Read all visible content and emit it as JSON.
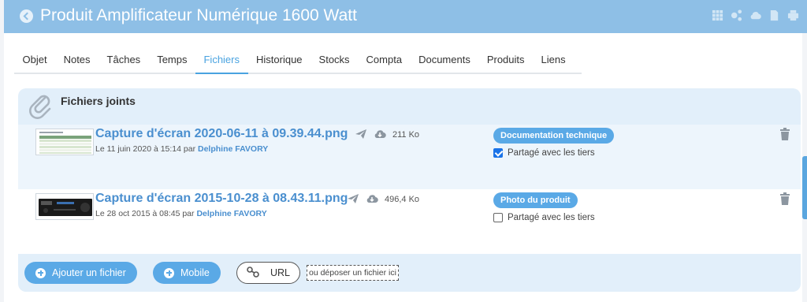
{
  "header": {
    "title": "Produit Amplificateur Numérique 1600 Watt",
    "icons": [
      "grid-icon",
      "share-network-icon",
      "cloud-download-icon",
      "document-icon",
      "print-icon"
    ]
  },
  "tabs": [
    {
      "label": "Objet"
    },
    {
      "label": "Notes"
    },
    {
      "label": "Tâches"
    },
    {
      "label": "Temps"
    },
    {
      "label": "Fichiers",
      "active": true
    },
    {
      "label": "Historique"
    },
    {
      "label": "Stocks"
    },
    {
      "label": "Compta"
    },
    {
      "label": "Documents"
    },
    {
      "label": "Produits"
    },
    {
      "label": "Liens"
    }
  ],
  "attachments": {
    "title": "Fichiers joints",
    "files": [
      {
        "name": "Capture d'écran 2020-06-11 à 09.39.44.png",
        "size": "211 Ko",
        "date": "Le 11 juin 2020 à 15:14 par ",
        "author": "Delphine FAVORY",
        "category": "Documentation technique",
        "shared_label": "Partagé avec les tiers",
        "shared": true
      },
      {
        "name": "Capture d'écran 2015-10-28 à 08.43.11.png",
        "size": "496,4 Ko",
        "date": "Le 28 oct 2015 à 08:45 par ",
        "author": "Delphine FAVORY",
        "category": "Photo du produit",
        "shared_label": "Partagé avec les tiers",
        "shared": false
      }
    ]
  },
  "actions": {
    "add_file": "Ajouter un fichier",
    "mobile": "Mobile",
    "url": "URL",
    "drop_hint": "ou déposer un fichier ici"
  },
  "colors": {
    "header_bg": "#8ebfe6",
    "accent": "#4aa3e0",
    "panel_bg": "#e2effa",
    "badge_bg": "#5aa9e6"
  }
}
